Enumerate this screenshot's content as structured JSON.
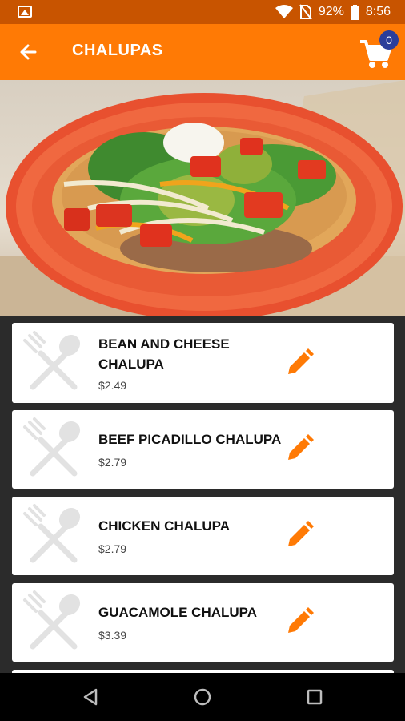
{
  "status_bar": {
    "battery_percent": "92%",
    "time": "8:56",
    "icons": [
      "image-icon",
      "wifi-icon",
      "no-sim-icon",
      "battery-icon"
    ]
  },
  "app_bar": {
    "title": "CHALUPAS",
    "back_icon": "arrow-left-icon",
    "cart_icon": "shopping-cart-icon",
    "cart_count": "0"
  },
  "hero": {
    "image": "chalupa-plate-photo"
  },
  "menu": {
    "items": [
      {
        "name": "BEAN AND CHEESE CHALUPA",
        "price": "$2.49",
        "thumb_icon": "fork-spoon-icon",
        "action_icon": "pencil-edit-icon"
      },
      {
        "name": "BEEF PICADILLO CHALUPA",
        "price": "$2.79",
        "thumb_icon": "fork-spoon-icon",
        "action_icon": "pencil-edit-icon"
      },
      {
        "name": "CHICKEN CHALUPA",
        "price": "$2.79",
        "thumb_icon": "fork-spoon-icon",
        "action_icon": "pencil-edit-icon"
      },
      {
        "name": "GUACAMOLE CHALUPA",
        "price": "$3.39",
        "thumb_icon": "fork-spoon-icon",
        "action_icon": "pencil-edit-icon"
      }
    ]
  },
  "nav_bar": {
    "back": "back-triangle-icon",
    "home": "home-circle-icon",
    "recents": "recents-square-icon"
  },
  "colors": {
    "app_bar": "#ff7a05",
    "status_bar": "#c85400",
    "accent": "#ff7a05",
    "badge": "#2c3e9a",
    "list_background": "#2b2b2b"
  }
}
